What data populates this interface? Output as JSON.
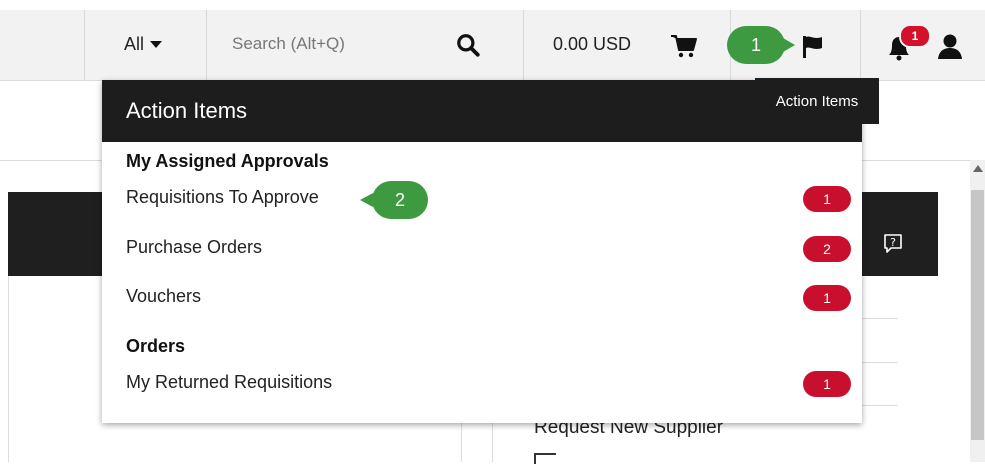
{
  "topbar": {
    "scope_label": "All",
    "search_placeholder": "Search (Alt+Q)",
    "cart_total": "0.00 USD",
    "notification_count": "1"
  },
  "callouts": {
    "step1": "1",
    "step2": "2"
  },
  "tooltip": "Action Items",
  "dropdown": {
    "title": "Action Items",
    "sections": [
      {
        "heading": "My Assigned Approvals",
        "items": [
          {
            "label": "Requisitions To Approve",
            "count": "1"
          },
          {
            "label": "Purchase Orders",
            "count": "2"
          },
          {
            "label": "Vouchers",
            "count": "1"
          }
        ]
      },
      {
        "heading": "Orders",
        "items": [
          {
            "label": "My Returned Requisitions",
            "count": "1"
          }
        ]
      }
    ]
  },
  "background": {
    "link_text": "Request New Supplier"
  },
  "colors": {
    "badge_red": "#c8102e",
    "callout_green": "#3d9a40",
    "header_dark": "#1d1d1d"
  },
  "icons": {
    "search": "search-icon",
    "cart": "cart-icon",
    "flag": "flag-icon",
    "bell": "bell-icon",
    "user": "user-icon",
    "help": "help-icon"
  }
}
